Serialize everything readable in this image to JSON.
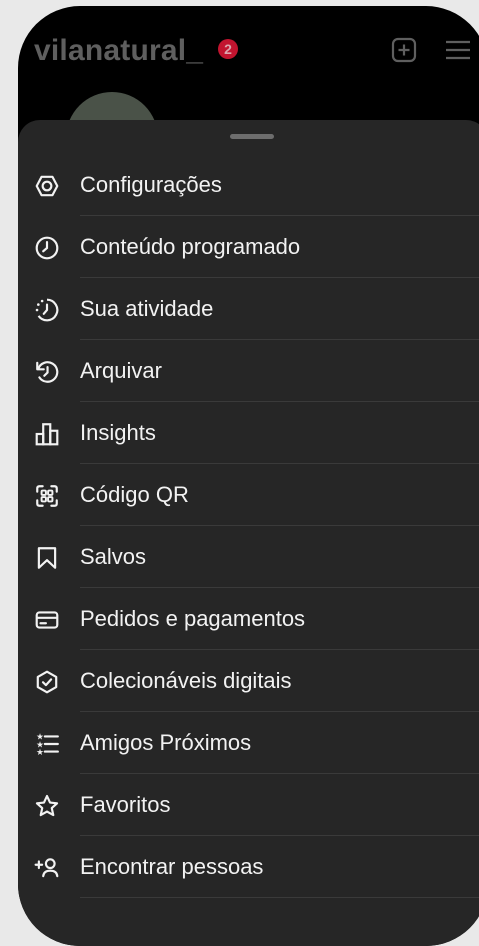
{
  "header": {
    "username": "vilanatural_",
    "notification_count": "2",
    "create_icon": "plus-square-icon",
    "menu_icon": "hamburger-menu-icon"
  },
  "menu": {
    "items": [
      {
        "label": "Configurações",
        "icon": "settings-gear-icon"
      },
      {
        "label": "Conteúdo programado",
        "icon": "clock-icon"
      },
      {
        "label": "Sua atividade",
        "icon": "activity-clock-icon"
      },
      {
        "label": "Arquivar",
        "icon": "archive-history-icon"
      },
      {
        "label": "Insights",
        "icon": "bar-chart-icon"
      },
      {
        "label": "Código QR",
        "icon": "qr-code-icon"
      },
      {
        "label": "Salvos",
        "icon": "bookmark-icon"
      },
      {
        "label": "Pedidos e pagamentos",
        "icon": "credit-card-icon"
      },
      {
        "label": "Colecionáveis digitais",
        "icon": "verified-shield-icon"
      },
      {
        "label": "Amigos Próximos",
        "icon": "close-friends-list-icon"
      },
      {
        "label": "Favoritos",
        "icon": "star-icon"
      },
      {
        "label": "Encontrar pessoas",
        "icon": "add-person-icon"
      }
    ]
  },
  "colors": {
    "sheet_background": "#262626",
    "text": "#f2f2f2",
    "badge": "#c2142f"
  }
}
